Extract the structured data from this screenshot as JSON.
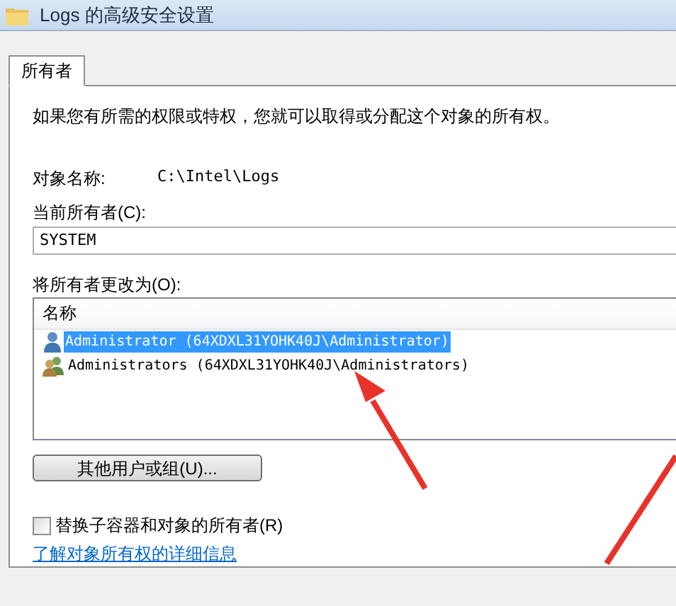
{
  "window": {
    "title": "Logs 的高级安全设置"
  },
  "tabs": [
    {
      "label": "所有者",
      "selected": true
    }
  ],
  "intro": "如果您有所需的权限或特权，您就可以取得或分配这个对象的所有权。",
  "object_name": {
    "label": "对象名称:",
    "value": "C:\\Intel\\Logs"
  },
  "current_owner": {
    "label": "当前所有者(C):",
    "value": "SYSTEM"
  },
  "change_owner": {
    "label": "将所有者更改为(O):",
    "columns": [
      "名称"
    ],
    "rows": [
      {
        "name": "Administrator (64XDXL31YOHK40J\\Administrator)",
        "kind": "user",
        "selected": true
      },
      {
        "name": "Administrators (64XDXL31YOHK40J\\Administrators)",
        "kind": "group",
        "selected": false
      }
    ]
  },
  "other_users_button": "其他用户或组(U)...",
  "replace_owner": {
    "label": "替换子容器和对象的所有者(R)",
    "checked": false
  },
  "link": "了解对象所有权的详细信息"
}
